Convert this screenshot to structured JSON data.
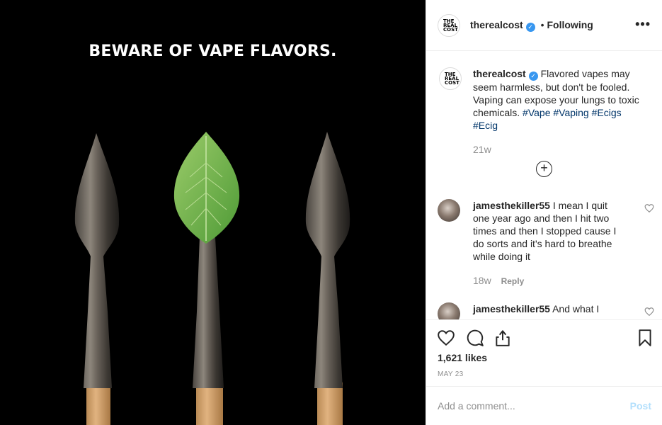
{
  "post_image": {
    "headline": "BEWARE OF VAPE FLAVORS.",
    "background_color": "#000000"
  },
  "header": {
    "logo_text": "THE REAL COST",
    "username": "therealcost",
    "separator": "•",
    "follow_status": "Following",
    "more_icon": "ellipsis-icon"
  },
  "caption": {
    "username": "therealcost",
    "text": "Flavored vapes may seem harmless, but don't be fooled. Vaping can expose your lungs to toxic chemicals.",
    "hashtags": [
      "#Vape",
      "#Vaping",
      "#Ecigs",
      "#Ecig"
    ],
    "time": "21w"
  },
  "load_more_icon": "plus-circle-icon",
  "comments": [
    {
      "username": "jamesthekiller55",
      "text": "I mean I quit one year ago and then I hit two times and then I stopped cause I do sorts and it's hard to breathe while doing it",
      "time": "18w",
      "reply_label": "Reply"
    },
    {
      "username": "jamesthekiller55",
      "text": "And what I"
    }
  ],
  "actions": {
    "icons": [
      "heart-icon",
      "comment-icon",
      "share-icon",
      "bookmark-icon"
    ],
    "likes": "1,621 likes",
    "date": "MAY 23"
  },
  "add_comment": {
    "placeholder": "Add a comment...",
    "post_label": "Post"
  },
  "colors": {
    "verified": "#3897f0",
    "hashtag": "#003569",
    "post_disabled": "#b2dffc",
    "muted": "#8e8e8e"
  }
}
